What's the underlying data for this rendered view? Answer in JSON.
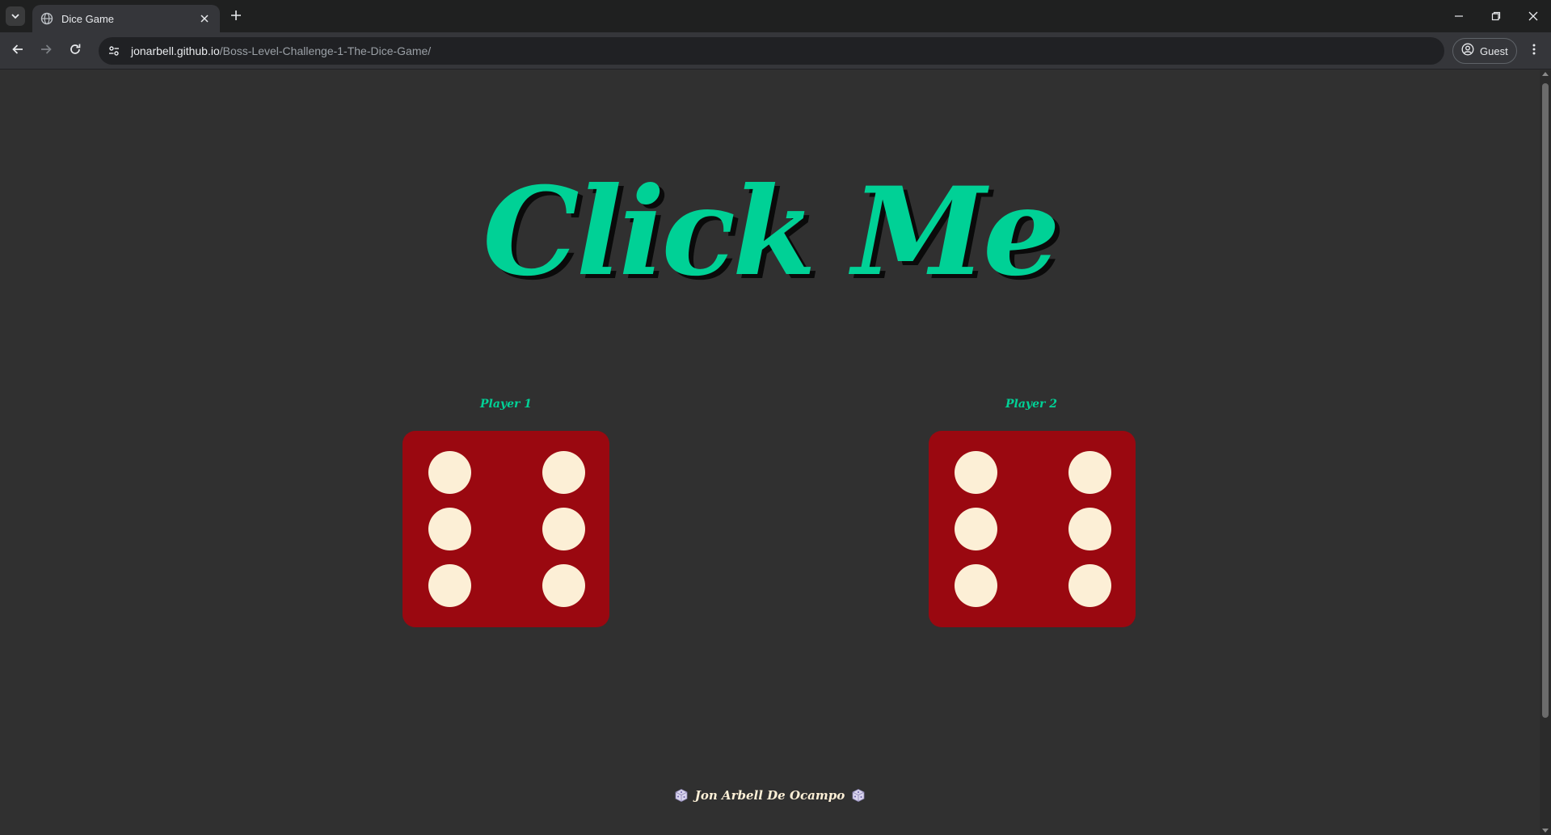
{
  "browser": {
    "tab_title": "Dice Game",
    "url_host": "jonarbell.github.io",
    "url_path": "/Boss-Level-Challenge-1-The-Dice-Game/",
    "profile_label": "Guest"
  },
  "page": {
    "headline": "Click Me",
    "player1_label": "Player 1",
    "player2_label": "Player 2",
    "player1_die_value": 6,
    "player2_die_value": 6,
    "footer_name": "Jon Arbell De Ocampo",
    "colors": {
      "accent": "#00d196",
      "die": "#9a0810",
      "pip": "#fcefd6",
      "background": "#303030"
    }
  }
}
